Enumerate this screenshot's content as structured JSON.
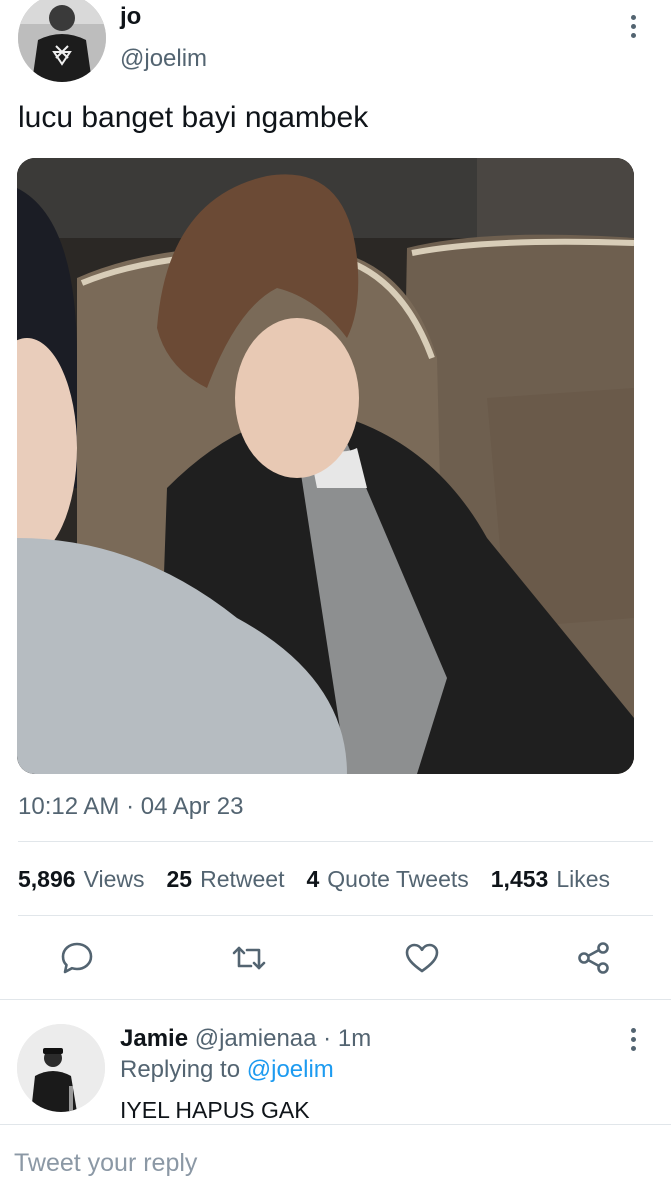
{
  "author": {
    "name": "jo",
    "handle": "@joelim"
  },
  "tweet": {
    "text": "lucu banget bayi ngambek",
    "timestamp": "10:12 AM · 04 Apr 23",
    "media_alt": "photo of a pouting young man in a black jacket sitting in a leather seat"
  },
  "stats": [
    {
      "value": "5,896",
      "label": "Views"
    },
    {
      "value": "25",
      "label": "Retweet"
    },
    {
      "value": "4",
      "label": "Quote Tweets"
    },
    {
      "value": "1,453",
      "label": "Likes"
    }
  ],
  "actions": [
    "reply-icon",
    "retweet-icon",
    "like-icon",
    "share-icon"
  ],
  "reply": {
    "name": "Jamie",
    "handle": "@jamienaa",
    "separator": "·",
    "time": "1m",
    "replying_prefix": "Replying to",
    "replying_handle": "@joelim",
    "text": "IYEL HAPUS GAK"
  },
  "composer": {
    "placeholder": "Tweet your reply"
  },
  "colors": {
    "secondary_text": "#536471",
    "link": "#1d9bf0",
    "divider": "#e1e6ea"
  }
}
